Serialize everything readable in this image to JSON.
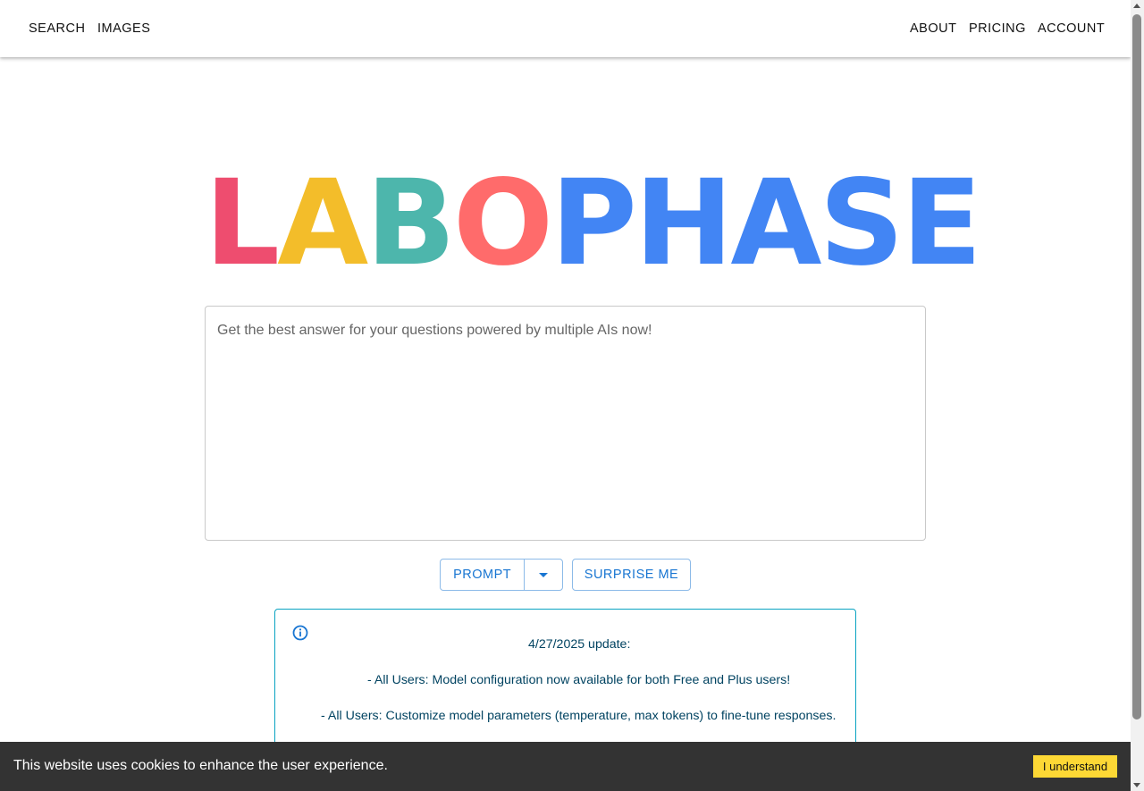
{
  "nav": {
    "left": {
      "search": "SEARCH",
      "images": "IMAGES"
    },
    "right": {
      "about": "ABOUT",
      "pricing": "PRICING",
      "account": "ACCOUNT"
    }
  },
  "logo": {
    "letters": [
      "L",
      "A",
      "B",
      "O",
      "P",
      "H",
      "A",
      "S",
      "E"
    ],
    "colors": [
      "#ee4d6f",
      "#f3bd2a",
      "#4db6ac",
      "#ff6b6b",
      "#4285f4",
      "#4285f4",
      "#4285f4",
      "#4285f4",
      "#4285f4"
    ]
  },
  "prompt": {
    "placeholder": "Get the best answer for your questions powered by multiple AIs now!",
    "value": ""
  },
  "buttons": {
    "prompt": "PROMPT",
    "surprise": "SURPRISE ME"
  },
  "alert": {
    "icon": "info-icon",
    "lines": [
      "4/27/2025 update:",
      "- All Users: Model configuration now available for both Free and Plus users!",
      "- All Users: Customize model parameters (temperature, max tokens) to fine-tune responses."
    ]
  },
  "cookie": {
    "text": "This website uses cookies to enhance the user experience.",
    "button": "I understand"
  },
  "colors": {
    "accent": "#1976d2",
    "cookie_button": "#fdd835",
    "alert_border": "#0aa3c2"
  }
}
